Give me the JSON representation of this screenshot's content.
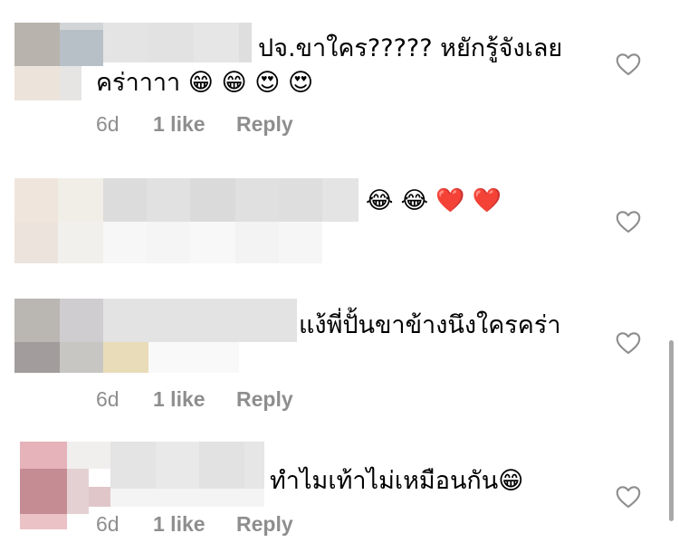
{
  "comments": [
    {
      "text_line1": "ปจ.ขาใคร????? หยักรู้จังเลย",
      "text_line2": "คร่าาาา 😁 😁 😍 😍",
      "time": "6d",
      "likes": "1 like",
      "reply": "Reply"
    },
    {
      "text_line1": "😂 😂 ❤️ ❤️"
    },
    {
      "text_line1": "แง้พี่ปั้นขาข้างนึงใครคร่า",
      "time": "6d",
      "likes": "1 like",
      "reply": "Reply"
    },
    {
      "text_line1": "ทำไมเท้าไม่เหมือนกัน😁",
      "time": "6d",
      "likes": "1 like",
      "reply": "Reply"
    }
  ],
  "icons": {
    "like": "heart-outline-icon"
  },
  "colors": {
    "meta": "#8e8e8e",
    "scrollbar": "#a8a8a8"
  }
}
